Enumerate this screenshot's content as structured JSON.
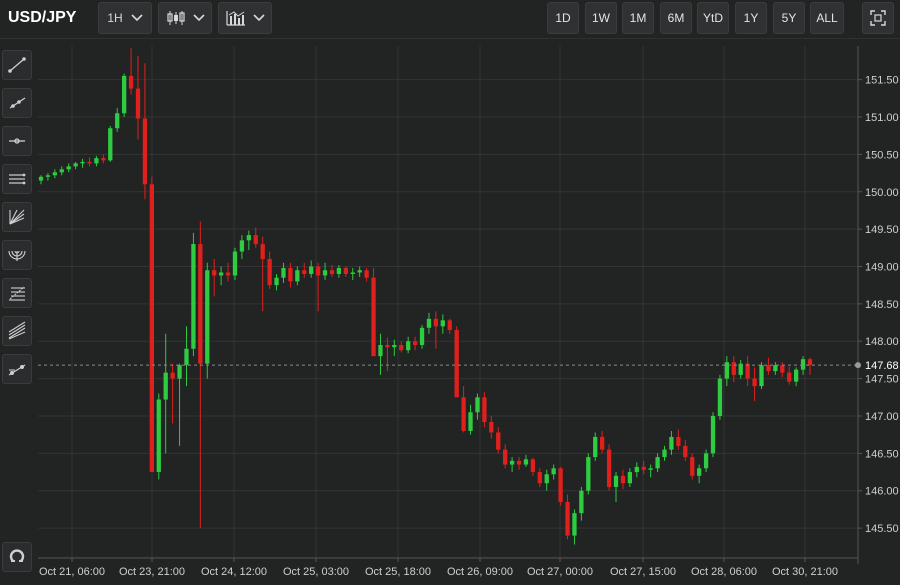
{
  "header": {
    "symbol": "USD/JPY",
    "interval_label": "1H",
    "candle_icon": "candlestick-icon",
    "indicator_icon": "indicators-icon",
    "fullscreen_icon": "fullscreen-icon",
    "ranges": [
      "1D",
      "1W",
      "1M",
      "6M",
      "YtD",
      "1Y",
      "5Y",
      "ALL"
    ]
  },
  "sidebar": {
    "tools": [
      "trend-line-icon",
      "ray-icon",
      "horizontal-line-icon",
      "parallel-channel-icon",
      "fib-fan-icon",
      "fib-arc-icon",
      "fib-retracement-icon",
      "pitchfork-icon",
      "measure-icon",
      "magnet-icon"
    ]
  },
  "colors": {
    "up": "#2ecc40",
    "down": "#e0201c",
    "grid": "#333435",
    "axis": "#555657",
    "price_line": "#8a8a8a"
  },
  "chart_data": {
    "type": "candlestick",
    "x_tick_labels": [
      "Oct 21, 06:00",
      "Oct 23, 21:00",
      "Oct 24, 12:00",
      "Oct 25, 03:00",
      "Oct 25, 18:00",
      "Oct 26, 09:00",
      "Oct 27, 00:00",
      "Oct 27, 15:00",
      "Oct 28, 06:00",
      "Oct 30, 21:00"
    ],
    "y_ticks": [
      145.5,
      146.0,
      146.5,
      147.0,
      147.5,
      148.0,
      148.5,
      149.0,
      149.5,
      150.0,
      150.5,
      151.0,
      151.5
    ],
    "y_tick_labels": [
      "145.50",
      "146.00",
      "146.50",
      "147.00",
      "147.50",
      "148.00",
      "148.50",
      "149.00",
      "149.50",
      "150.00",
      "150.50",
      "151.00",
      "151.50"
    ],
    "ylim": [
      145.1,
      151.95
    ],
    "grid": true,
    "last_price": 147.68,
    "last_price_label": "147.68",
    "ohlc": [
      [
        150.15,
        150.22,
        150.1,
        150.2
      ],
      [
        150.2,
        150.25,
        150.15,
        150.22
      ],
      [
        150.22,
        150.3,
        150.18,
        150.26
      ],
      [
        150.26,
        150.34,
        150.22,
        150.3
      ],
      [
        150.3,
        150.38,
        150.26,
        150.34
      ],
      [
        150.34,
        150.4,
        150.3,
        150.38
      ],
      [
        150.38,
        150.44,
        150.32,
        150.4
      ],
      [
        150.4,
        150.46,
        150.34,
        150.38
      ],
      [
        150.38,
        150.48,
        150.34,
        150.45
      ],
      [
        150.45,
        150.5,
        150.38,
        150.42
      ],
      [
        150.42,
        150.88,
        150.4,
        150.85
      ],
      [
        150.85,
        151.12,
        150.8,
        151.05
      ],
      [
        151.05,
        151.58,
        151.0,
        151.55
      ],
      [
        151.55,
        151.92,
        151.3,
        151.38
      ],
      [
        151.38,
        151.82,
        150.7,
        150.98
      ],
      [
        150.98,
        151.72,
        149.9,
        150.1
      ],
      [
        150.1,
        150.2,
        146.3,
        146.25
      ],
      [
        146.25,
        147.3,
        146.15,
        147.22
      ],
      [
        147.22,
        148.1,
        146.5,
        147.58
      ],
      [
        147.58,
        147.7,
        146.9,
        147.5
      ],
      [
        147.5,
        147.7,
        146.6,
        147.68
      ],
      [
        147.68,
        148.2,
        147.4,
        147.9
      ],
      [
        147.9,
        149.45,
        147.8,
        149.3
      ],
      [
        149.3,
        149.6,
        145.5,
        147.7
      ],
      [
        147.7,
        149.05,
        147.5,
        148.95
      ],
      [
        148.95,
        149.1,
        148.6,
        148.88
      ],
      [
        148.88,
        149.0,
        148.75,
        148.92
      ],
      [
        148.92,
        149.05,
        148.8,
        148.88
      ],
      [
        148.88,
        149.25,
        148.82,
        149.2
      ],
      [
        149.2,
        149.42,
        149.1,
        149.35
      ],
      [
        149.35,
        149.48,
        149.22,
        149.42
      ],
      [
        149.42,
        149.52,
        149.25,
        149.3
      ],
      [
        149.3,
        149.4,
        148.4,
        149.1
      ],
      [
        149.1,
        149.2,
        148.7,
        148.75
      ],
      [
        148.75,
        148.9,
        148.68,
        148.85
      ],
      [
        148.85,
        149.05,
        148.78,
        148.98
      ],
      [
        148.98,
        149.05,
        148.72,
        148.8
      ],
      [
        148.8,
        149.0,
        148.75,
        148.95
      ],
      [
        148.95,
        149.05,
        148.85,
        148.9
      ],
      [
        148.9,
        149.08,
        148.85,
        149.0
      ],
      [
        149.0,
        149.05,
        148.4,
        148.88
      ],
      [
        148.88,
        149.05,
        148.82,
        148.95
      ],
      [
        148.95,
        149.02,
        148.86,
        148.9
      ],
      [
        148.9,
        149.02,
        148.85,
        148.98
      ],
      [
        148.98,
        149.0,
        148.86,
        148.9
      ],
      [
        148.9,
        148.98,
        148.82,
        148.92
      ],
      [
        148.92,
        149.0,
        148.86,
        148.95
      ],
      [
        148.95,
        148.98,
        148.8,
        148.85
      ],
      [
        148.85,
        148.98,
        148.0,
        147.8
      ],
      [
        147.8,
        148.1,
        147.55,
        147.95
      ],
      [
        147.95,
        148.05,
        147.6,
        147.92
      ],
      [
        147.92,
        148.02,
        147.8,
        147.95
      ],
      [
        147.95,
        148.0,
        147.85,
        147.88
      ],
      [
        147.88,
        148.06,
        147.84,
        148.0
      ],
      [
        148.0,
        148.06,
        147.88,
        147.95
      ],
      [
        147.95,
        148.22,
        147.9,
        148.18
      ],
      [
        148.18,
        148.38,
        148.1,
        148.3
      ],
      [
        148.3,
        148.4,
        147.9,
        148.2
      ],
      [
        148.2,
        148.36,
        148.1,
        148.28
      ],
      [
        148.28,
        148.3,
        148.1,
        148.15
      ],
      [
        148.15,
        148.2,
        147.75,
        147.25
      ],
      [
        147.25,
        147.4,
        146.78,
        146.8
      ],
      [
        146.8,
        147.15,
        146.75,
        147.05
      ],
      [
        147.05,
        147.3,
        146.95,
        147.25
      ],
      [
        147.25,
        147.32,
        146.85,
        146.92
      ],
      [
        146.92,
        147.0,
        146.7,
        146.78
      ],
      [
        146.78,
        146.85,
        146.5,
        146.55
      ],
      [
        146.55,
        146.62,
        146.3,
        146.35
      ],
      [
        146.35,
        146.45,
        146.25,
        146.4
      ],
      [
        146.4,
        146.45,
        146.28,
        146.35
      ],
      [
        146.35,
        146.48,
        146.32,
        146.42
      ],
      [
        146.42,
        146.44,
        146.2,
        146.25
      ],
      [
        146.25,
        146.3,
        146.05,
        146.1
      ],
      [
        146.1,
        146.28,
        146.0,
        146.22
      ],
      [
        146.22,
        146.35,
        146.15,
        146.3
      ],
      [
        146.3,
        146.32,
        145.8,
        145.85
      ],
      [
        145.85,
        145.95,
        145.35,
        145.4
      ],
      [
        145.4,
        145.75,
        145.28,
        145.7
      ],
      [
        145.7,
        146.05,
        145.6,
        146.0
      ],
      [
        146.0,
        146.5,
        145.95,
        146.45
      ],
      [
        146.45,
        146.78,
        146.4,
        146.72
      ],
      [
        146.72,
        146.8,
        146.5,
        146.55
      ],
      [
        146.55,
        146.62,
        146.0,
        146.05
      ],
      [
        146.05,
        146.25,
        145.85,
        146.2
      ],
      [
        146.2,
        146.28,
        146.02,
        146.1
      ],
      [
        146.1,
        146.3,
        146.05,
        146.25
      ],
      [
        146.25,
        146.38,
        146.18,
        146.32
      ],
      [
        146.32,
        146.4,
        146.22,
        146.28
      ],
      [
        146.28,
        146.35,
        146.18,
        146.3
      ],
      [
        146.3,
        146.5,
        146.25,
        146.45
      ],
      [
        146.45,
        146.6,
        146.4,
        146.55
      ],
      [
        146.55,
        146.8,
        146.48,
        146.72
      ],
      [
        146.72,
        146.82,
        146.55,
        146.6
      ],
      [
        146.6,
        146.68,
        146.4,
        146.45
      ],
      [
        146.45,
        146.5,
        146.15,
        146.2
      ],
      [
        146.2,
        146.35,
        146.1,
        146.3
      ],
      [
        146.3,
        146.55,
        146.25,
        146.5
      ],
      [
        146.5,
        147.05,
        146.45,
        147.0
      ],
      [
        147.0,
        147.55,
        146.95,
        147.5
      ],
      [
        147.5,
        147.8,
        147.4,
        147.72
      ],
      [
        147.72,
        147.8,
        147.45,
        147.55
      ],
      [
        147.55,
        147.75,
        147.5,
        147.7
      ],
      [
        147.7,
        147.8,
        147.4,
        147.5
      ],
      [
        147.5,
        147.65,
        147.2,
        147.4
      ],
      [
        147.4,
        147.72,
        147.36,
        147.68
      ],
      [
        147.68,
        147.78,
        147.55,
        147.6
      ],
      [
        147.6,
        147.72,
        147.55,
        147.68
      ],
      [
        147.68,
        147.72,
        147.52,
        147.58
      ],
      [
        147.58,
        147.66,
        147.42,
        147.46
      ],
      [
        147.46,
        147.65,
        147.4,
        147.62
      ],
      [
        147.62,
        147.8,
        147.55,
        147.76
      ],
      [
        147.76,
        147.78,
        147.55,
        147.68
      ]
    ]
  }
}
